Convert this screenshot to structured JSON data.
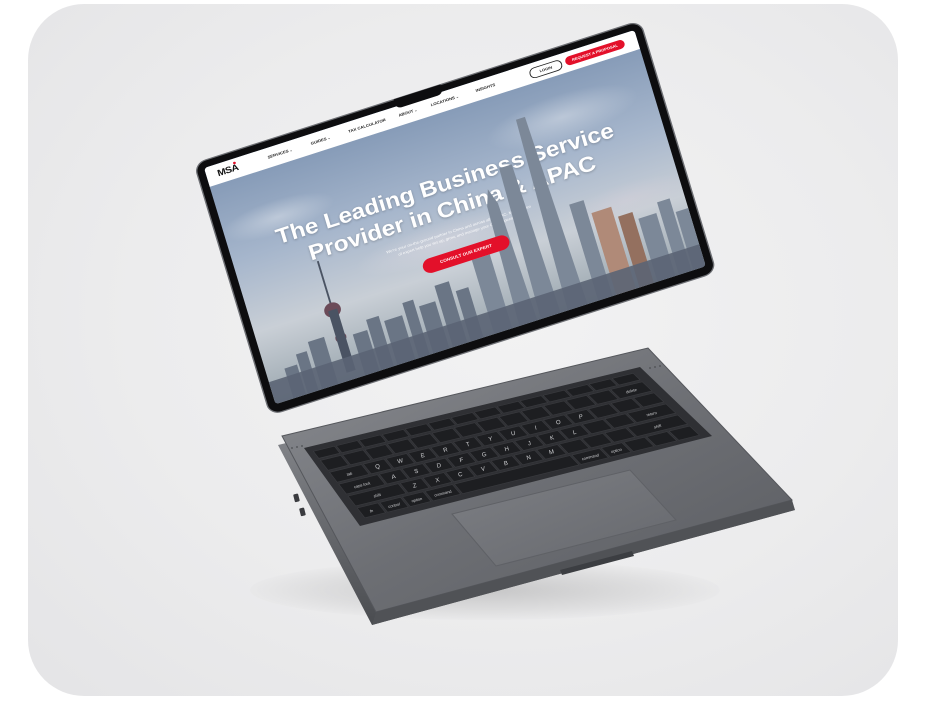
{
  "website": {
    "logo": "MSA",
    "nav": {
      "services": "SERVICES",
      "guides": "GUIDES",
      "tax_calculator": "TAX CALCULATOR",
      "about": "ABOUT",
      "locations": "LOCATIONS",
      "insights": "INSIGHTS"
    },
    "buttons": {
      "login": "LOGIN",
      "request_proposal": "REQUEST A PROPOSAL",
      "consult": "CONSULT OUR EXPERT"
    },
    "hero": {
      "title_line1": "The Leading Business Service",
      "title_line2": "Provider in China & APAC",
      "subtitle_line1": "We're your on-the-ground partner in China and across all of APAC. MSA's team",
      "subtitle_line2": "of expert help you set up, grow, and manage your China operations."
    }
  },
  "colors": {
    "accent": "#e3102a",
    "chassis": "#6f7176",
    "bezel": "#0d0d0f"
  },
  "keyboard": {
    "keys": {
      "esc": "esc",
      "tab": "tab",
      "caps": "caps lock",
      "shift": "shift",
      "fn": "fn",
      "control": "control",
      "option": "option",
      "command_left": "command",
      "command_right": "command",
      "option_right": "option",
      "delete": "delete",
      "return": "return",
      "shift_right": "shift"
    },
    "letters_row1": [
      "Q",
      "W",
      "E",
      "R",
      "T",
      "Y",
      "U",
      "I",
      "O",
      "P"
    ],
    "letters_row2": [
      "A",
      "S",
      "D",
      "F",
      "G",
      "H",
      "J",
      "K",
      "L"
    ],
    "letters_row3": [
      "Z",
      "X",
      "C",
      "V",
      "B",
      "N",
      "M"
    ]
  }
}
